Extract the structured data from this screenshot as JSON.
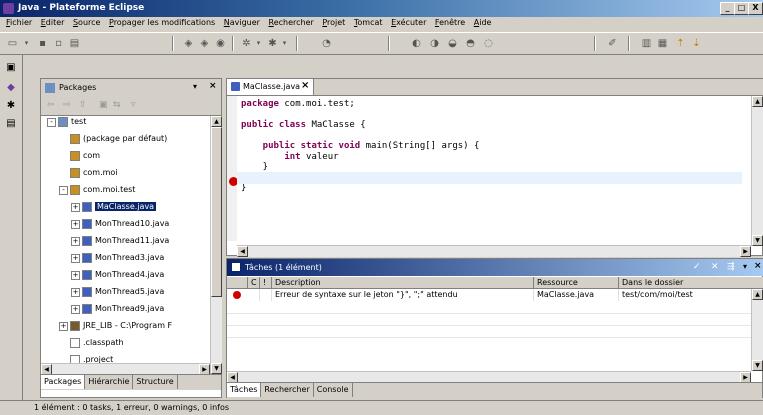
{
  "window": {
    "title": "Java - Plateforme Eclipse",
    "min": "_",
    "max": "□",
    "close": "X"
  },
  "menu": [
    "Fichier",
    "Editer",
    "Source",
    "Propager les modifications",
    "Naviguer",
    "Rechercher",
    "Projet",
    "Tomcat",
    "Exécuter",
    "Fenêtre",
    "Aide"
  ],
  "packages": {
    "title": "Packages",
    "items": [
      {
        "label": "test",
        "indent": 0,
        "exp": "-"
      },
      {
        "label": "(package par défaut)",
        "indent": 1,
        "exp": ""
      },
      {
        "label": "com",
        "indent": 1,
        "exp": ""
      },
      {
        "label": "com.moi",
        "indent": 1,
        "exp": ""
      },
      {
        "label": "com.moi.test",
        "indent": 1,
        "exp": "-"
      },
      {
        "label": "MaClasse.java",
        "indent": 2,
        "exp": "+",
        "selected": true
      },
      {
        "label": "MonThread10.java",
        "indent": 2,
        "exp": "+"
      },
      {
        "label": "MonThread11.java",
        "indent": 2,
        "exp": "+"
      },
      {
        "label": "MonThread3.java",
        "indent": 2,
        "exp": "+"
      },
      {
        "label": "MonThread4.java",
        "indent": 2,
        "exp": "+"
      },
      {
        "label": "MonThread5.java",
        "indent": 2,
        "exp": "+"
      },
      {
        "label": "MonThread9.java",
        "indent": 2,
        "exp": "+"
      },
      {
        "label": "JRE_LIB - C:\\Program F",
        "indent": 1,
        "exp": "+"
      },
      {
        "label": ".classpath",
        "indent": 1,
        "exp": ""
      },
      {
        "label": ".project",
        "indent": 1,
        "exp": ""
      }
    ],
    "tabs": [
      "Packages",
      "Hiérarchie",
      "Structure"
    ]
  },
  "editor": {
    "tab": "MaClasse.java",
    "lines": [
      {
        "kw": "package",
        "rest": " com.moi.test;"
      },
      {
        "kw": "",
        "rest": ""
      },
      {
        "kw": "public class",
        "rest": " MaClasse {"
      },
      {
        "kw": "",
        "rest": ""
      },
      {
        "kw": "    public static void",
        "rest": " main(String[] args) {"
      },
      {
        "kw": "        int",
        "rest": " valeur"
      },
      {
        "kw": "",
        "rest": "    }"
      },
      {
        "kw": "",
        "rest": ""
      },
      {
        "kw": "",
        "rest": "}"
      }
    ]
  },
  "tasks": {
    "title": "Tâches (1 élément)",
    "columns": [
      "C",
      "!",
      "Description",
      "Ressource",
      "Dans le dossier"
    ],
    "rows": [
      {
        "c": "",
        "p": "",
        "description": "Erreur de syntaxe sur le jeton \"}\", \";\" attendu",
        "resource": "MaClasse.java",
        "folder": "test/com/moi/test"
      }
    ],
    "tabs": [
      "Tâches",
      "Rechercher",
      "Console"
    ]
  },
  "status": "1 élément : 0 tasks, 1 erreur, 0 warnings, 0 infos",
  "colors": {
    "keyword": "#7f0055",
    "titlebar": "#0a246a",
    "error": "#d00000"
  }
}
